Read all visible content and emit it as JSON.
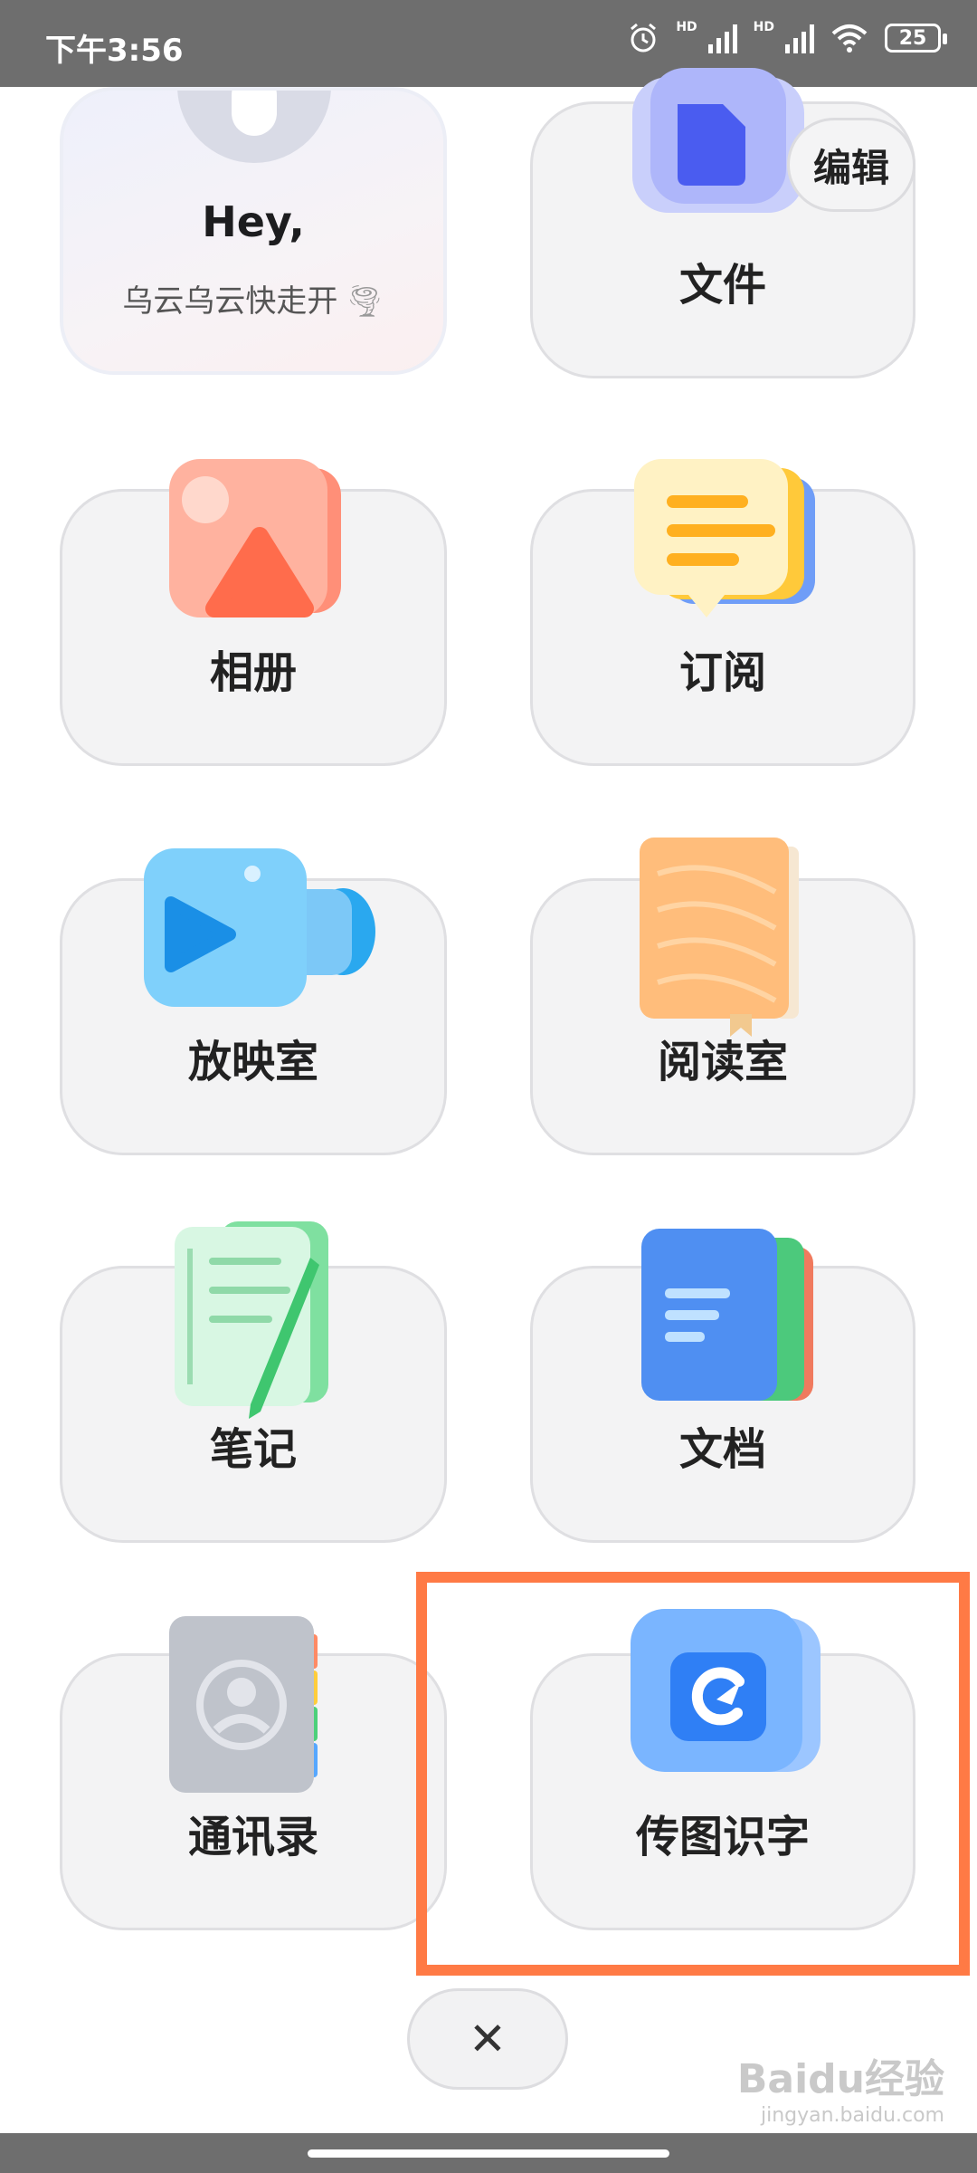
{
  "status_bar": {
    "time": "下午3:56",
    "battery": "25",
    "signal1_label": "HD",
    "signal2_label": "HD"
  },
  "profile": {
    "greeting": "Hey,",
    "subtitle": "乌云乌云快走开"
  },
  "edit_label": "编辑",
  "apps": [
    {
      "label": "文件",
      "icon": "file-folder-icon"
    },
    {
      "label": "相册",
      "icon": "photo-album-icon"
    },
    {
      "label": "订阅",
      "icon": "subscription-icon"
    },
    {
      "label": "放映室",
      "icon": "video-camera-icon"
    },
    {
      "label": "阅读室",
      "icon": "book-icon"
    },
    {
      "label": "笔记",
      "icon": "notes-icon"
    },
    {
      "label": "文档",
      "icon": "document-icon"
    },
    {
      "label": "通讯录",
      "icon": "contacts-icon"
    },
    {
      "label": "传图识字",
      "icon": "ocr-icon"
    }
  ],
  "close_label": "✕",
  "watermark": {
    "brand": "Baidu经验",
    "url": "jingyan.baidu.com"
  },
  "colors": {
    "highlight": "#ff7a45",
    "status_bar": "#6e6e6e",
    "card_bg": "#f3f3f4"
  }
}
